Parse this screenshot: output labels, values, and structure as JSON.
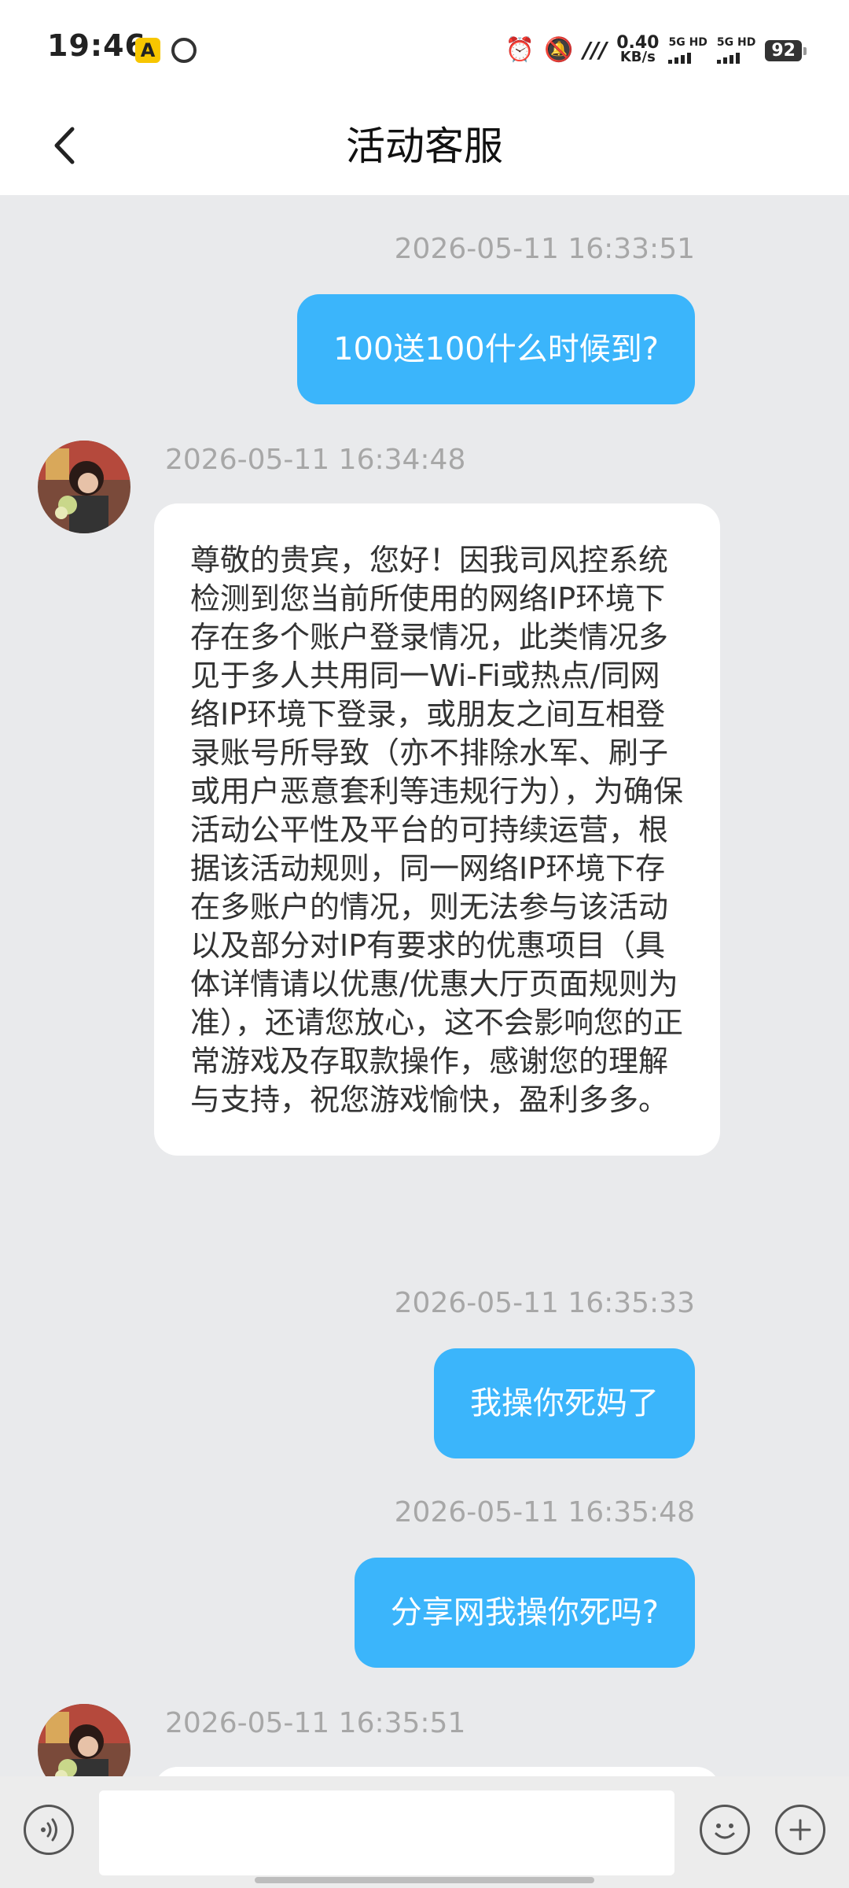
{
  "status_bar": {
    "time": "19:46",
    "net_speed_value": "0.40",
    "net_speed_unit": "KB/s",
    "sim1": "5G HD",
    "sim2": "5G HD",
    "battery": "92"
  },
  "header": {
    "title": "活动客服"
  },
  "messages": [
    {
      "from": "user",
      "time": "2026-05-11 16:33:51",
      "text": "100送100什么时候到?"
    },
    {
      "from": "agent",
      "time": "2026-05-11 16:34:48",
      "text": "尊敬的贵宾，您好！因我司风控系统检测到您当前所使用的网络IP环境下存在多个账户登录情况，此类情况多见于多人共用同一Wi-Fi或热点/同网络IP环境下登录，或朋友之间互相登录账号所导致（亦不排除水军、刷子或用户恶意套利等违规行为），为确保活动公平性及平台的可持续运营，根据该活动规则，同一网络IP环境下存在多账户的情况，则无法参与该活动以及部分对IP有要求的优惠项目（具体详情请以优惠/优惠大厅页面规则为准），还请您放心，这不会影响您的正常游戏及存取款操作，感谢您的理解与支持，祝您游戏愉快，盈利多多。"
    },
    {
      "from": "user",
      "time": "2026-05-11 16:35:33",
      "text": "我操你死妈了"
    },
    {
      "from": "user",
      "time": "2026-05-11 16:35:48",
      "text": "分享网我操你死吗?"
    },
    {
      "from": "agent",
      "time": "2026-05-11 16:35:51",
      "text": ""
    }
  ],
  "input": {
    "value": "",
    "placeholder": ""
  },
  "icons": {
    "back": "chevron-left-icon",
    "voice": "voice-icon",
    "emoji": "emoji-icon",
    "add": "plus-icon"
  },
  "colors": {
    "outgoing_bubble": "#3bb5fb",
    "background": "#e9eaec"
  }
}
